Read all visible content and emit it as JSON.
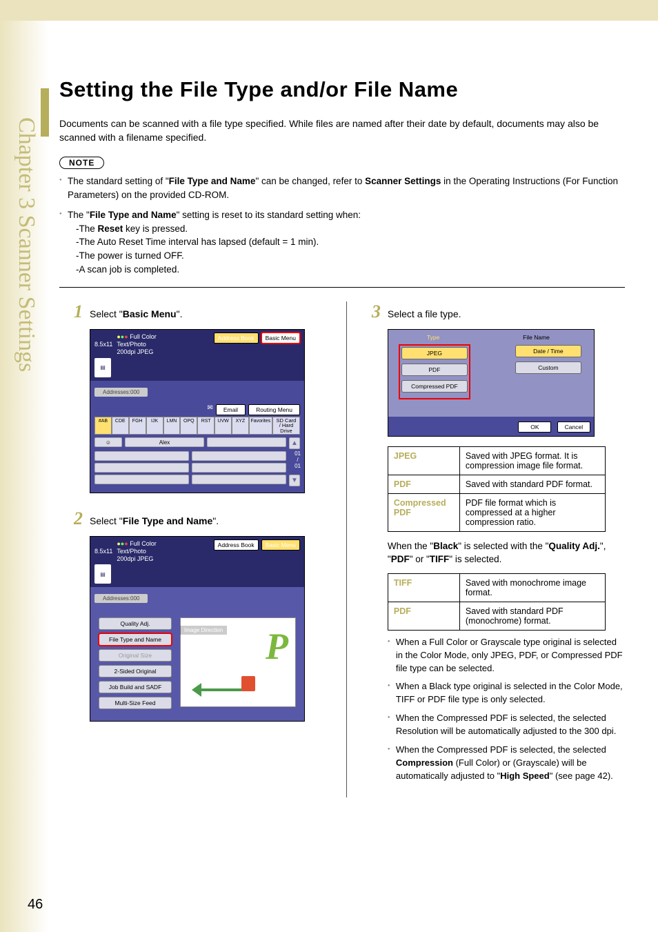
{
  "meta": {
    "chapter_tab": "Chapter 3    Scanner Settings",
    "page_number": "46"
  },
  "heading": "Setting the File Type and/or File Name",
  "intro": "Documents can be scanned with a file type specified. While files are named after their date by default, documents may also be scanned with a filename specified.",
  "note_label": "NOTE",
  "notes": {
    "n1a": "The standard setting of \"",
    "n1b": "File Type and Name",
    "n1c": "\" can be changed, refer to ",
    "n1d": "Scanner Settings",
    "n1e": " in the Operating Instructions (For Function Parameters) on the provided CD-ROM.",
    "n2a": "The \"",
    "n2b": "File Type and Name",
    "n2c": "\" setting is reset to its standard setting when:",
    "sub1": "-The ",
    "sub1b": "Reset",
    "sub1c": " key is pressed.",
    "sub2": "-The Auto Reset Time interval has lapsed (default = 1 min).",
    "sub3": "-The power is turned OFF.",
    "sub4": "-A scan job is completed."
  },
  "steps": {
    "s1_num": "1",
    "s1a": "Select \"",
    "s1b": "Basic Menu",
    "s1c": "\".",
    "s2_num": "2",
    "s2a": "Select \"",
    "s2b": "File Type and Name",
    "s2c": "\".",
    "s3_num": "3",
    "s3": "Select a file type."
  },
  "screenshot1": {
    "paper": "8.5x11",
    "color": "Full Color",
    "mode": "Text/Photo",
    "res": "200dpi JPEG",
    "addr_btn": "Address Book",
    "basic_btn": "Basic Menu",
    "addresses": "Addresses:000",
    "email": "Email",
    "routing": "Routing Menu",
    "tabs": [
      "#AB",
      "CDE",
      "FGH",
      "IJK",
      "LMN",
      "OPQ",
      "RST",
      "UVW",
      "XYZ",
      "Favorites"
    ],
    "sd": "SD Card / Hard Drive",
    "alex": "Alex",
    "page_ind_top": "01",
    "page_ind_mid": "/",
    "page_ind_bot": "01"
  },
  "screenshot2": {
    "paper": "8.5x11",
    "color": "Full Color",
    "mode": "Text/Photo",
    "res": "200dpi JPEG",
    "addr_btn": "Address Book",
    "basic_btn": "Basic Menu",
    "addresses": "Addresses:000",
    "image_dir": "Image Direction",
    "items": [
      "Quality Adj.",
      "File Type and Name",
      "Original Size",
      "2-Sided Original",
      "Job Build and SADF",
      "Multi-Size Feed"
    ]
  },
  "screenshot3": {
    "type_label": "Type",
    "name_label": "File Name",
    "types": [
      "JPEG",
      "PDF",
      "Compressed PDF"
    ],
    "names": [
      "Date / Time",
      "Custom"
    ],
    "ok": "OK",
    "cancel": "Cancel"
  },
  "table1": {
    "r1k": "JPEG",
    "r1v": "Saved with JPEG format. It is compression image file format.",
    "r2k": "PDF",
    "r2v": "Saved with standard PDF format.",
    "r3k": "Compressed PDF",
    "r3v": "PDF file format which is compressed at a higher compression ratio."
  },
  "between_tables": {
    "a": "When the \"",
    "b": "Black",
    "c": "\" is selected with the \"",
    "d": "Quality Adj.",
    "e": "\", \"",
    "f": "PDF",
    "g": "\" or \"",
    "h": "TIFF",
    "i": "\" is selected."
  },
  "table2": {
    "r1k": "TIFF",
    "r1v": "Saved with monochrome image format.",
    "r2k": "PDF",
    "r2v": "Saved with standard PDF (monochrome) format."
  },
  "bullets": {
    "b1": "When a Full Color or Grayscale type original is selected in the Color Mode, only JPEG, PDF, or Compressed PDF file type can be selected.",
    "b2": "When a Black type original is selected in the Color Mode, TIFF or PDF file type is only selected.",
    "b3": "When the Compressed PDF is selected, the selected Resolution will be automatically adjusted to the 300 dpi.",
    "b4a": "When the Compressed PDF is selected, the selected ",
    "b4b": "Compression",
    "b4c": " (Full Color) or (Grayscale) will be automatically adjusted to \"",
    "b4d": "High Speed",
    "b4e": "\" (see page 42)."
  }
}
